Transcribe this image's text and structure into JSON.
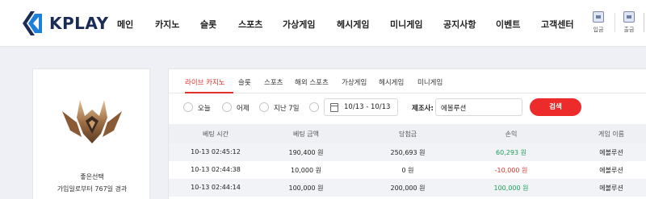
{
  "brand": {
    "logo_text": "KPLAY",
    "colors": {
      "logo_blue": "#1c7fd9",
      "logo_navy": "#1a2b55"
    }
  },
  "nav": {
    "items": [
      "메인",
      "카지노",
      "슬롯",
      "스포츠",
      "가상게임",
      "헤시게임",
      "미니게임",
      "공지사항",
      "이벤트",
      "고객센터"
    ]
  },
  "utility": {
    "deposit_label": "입금",
    "withdraw_label": "출금",
    "deposit_icon": "wallet-in-icon",
    "withdraw_icon": "wallet-out-icon"
  },
  "profile": {
    "name": "좋은선택",
    "subtitle": "가입일로부터 767일 경과",
    "emblem_icon": "rank-emblem-icon"
  },
  "tabs": {
    "items": [
      "라이브 카지노",
      "슬롯",
      "스포츠",
      "해외 스포츠",
      "가상게임",
      "헤시게임",
      "미니게임"
    ],
    "active_index": 0
  },
  "filters": {
    "options": [
      "오늘",
      "어제",
      "지난 7일"
    ],
    "date_range": "10/13 - 10/13",
    "maker_label": "제조사:",
    "maker_value": "에볼루션",
    "search_label": "검색"
  },
  "table": {
    "columns": [
      "베팅 시간",
      "베팅 금액",
      "당첨금",
      "손익",
      "게임 이름"
    ],
    "rows": [
      {
        "time": "10-13 02:45:12",
        "bet": "190,400 원",
        "win": "250,693 원",
        "profit": "60,293 원",
        "profit_sign": "pos",
        "game": "에볼루션"
      },
      {
        "time": "10-13 02:44:38",
        "bet": "10,000 원",
        "win": "0 원",
        "profit": "-10,000 원",
        "profit_sign": "neg",
        "game": "에볼루션"
      },
      {
        "time": "10-13 02:44:14",
        "bet": "100,000 원",
        "win": "200,000 원",
        "profit": "100,000 원",
        "profit_sign": "pos",
        "game": "에볼루션"
      }
    ]
  },
  "colors": {
    "accent_red": "#e0312b",
    "positive_green": "#1aa05a"
  }
}
